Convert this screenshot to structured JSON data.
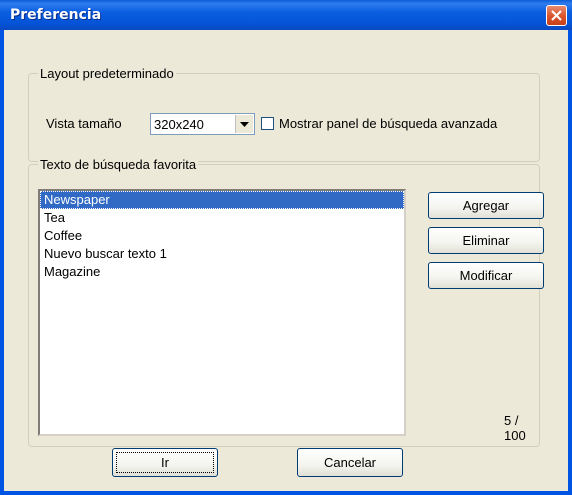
{
  "window": {
    "title": "Preferencia"
  },
  "layout_group": {
    "legend": "Layout predeterminado",
    "size_label": "Vista tamaño",
    "size_value": "320x240",
    "advanced_checkbox_label": "Mostrar panel de búsqueda avanzada",
    "advanced_checked": false
  },
  "favorites_group": {
    "legend": "Texto de búsqueda favorita",
    "items": [
      "Newspaper",
      "Tea",
      "Coffee",
      "Nuevo buscar texto 1",
      "Magazine"
    ],
    "selected_index": 0,
    "add_label": "Agregar",
    "delete_label": "Eliminar",
    "modify_label": "Modificar",
    "count": "5 / 100"
  },
  "footer": {
    "go_label": "Ir",
    "cancel_label": "Cancelar"
  },
  "colors": {
    "titlebar": "#0054e3",
    "dialog_bg": "#ece9d8",
    "selection": "#316ac5",
    "close_button": "#d9542a"
  }
}
